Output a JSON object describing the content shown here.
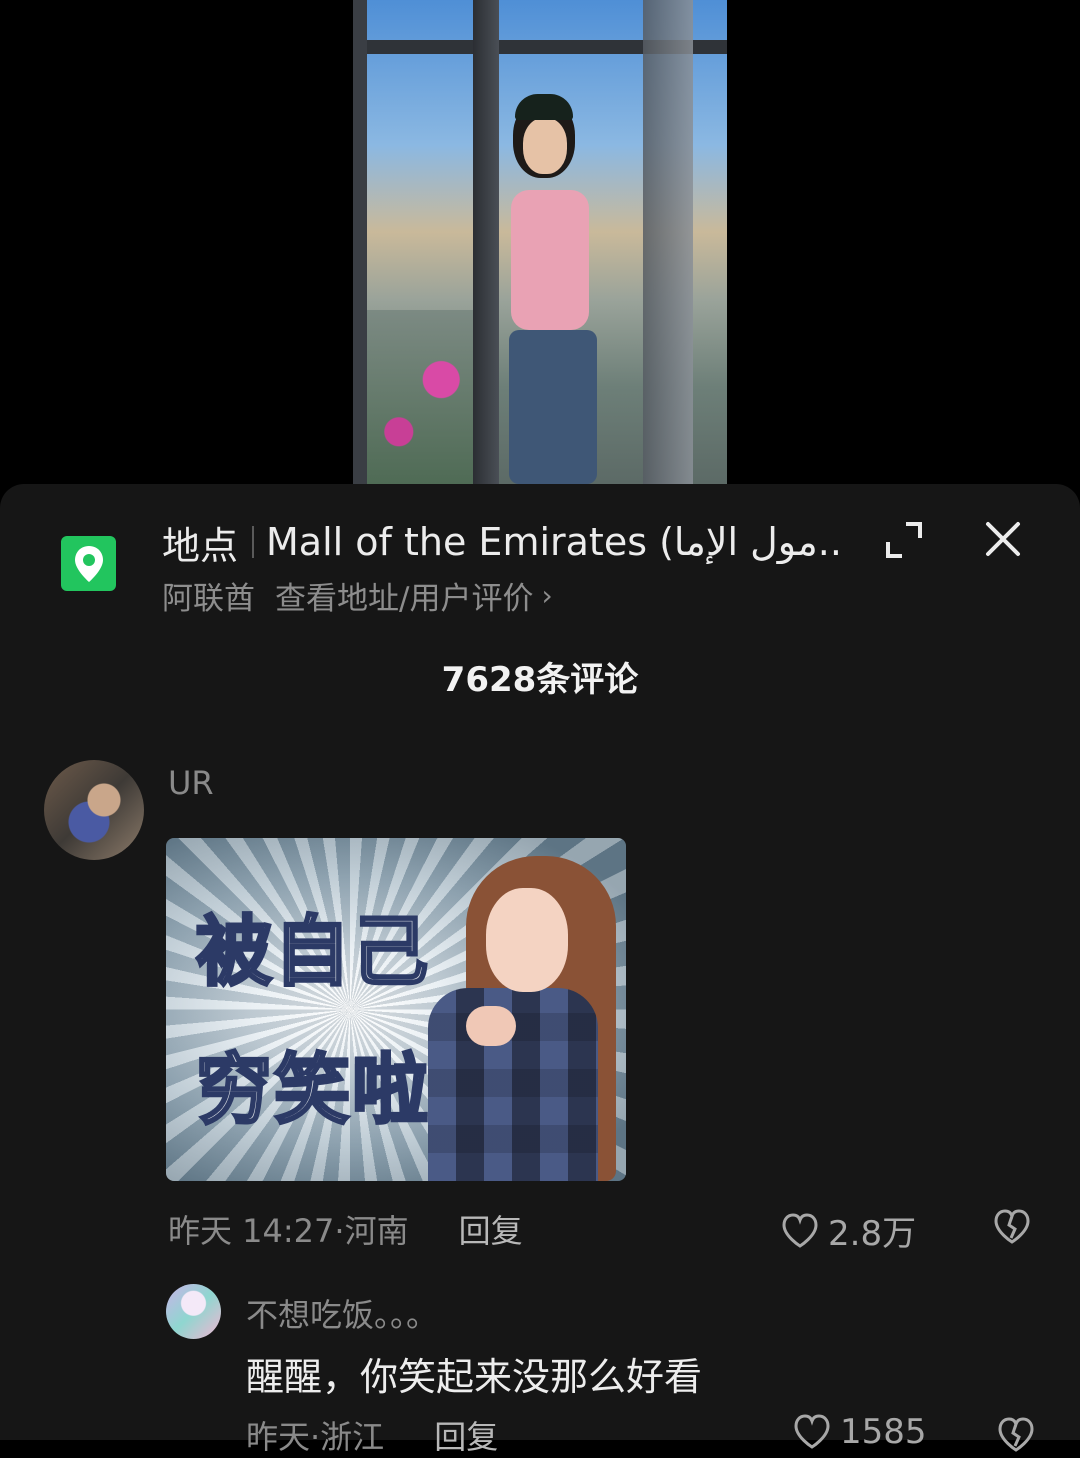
{
  "location": {
    "label": "地点",
    "name": "Mall of the Emirates (مول الإما..",
    "country": "阿联酋",
    "detail_link": "查看地址/用户评价"
  },
  "comments_header": {
    "count_text": "7628条评论"
  },
  "comments": [
    {
      "username": "UR",
      "sticker_text_line1": "被自己",
      "sticker_text_line2": "穷笑啦",
      "time_location": "昨天 14:27·河南",
      "reply_label": "回复",
      "likes": "2.8万",
      "replies": [
        {
          "username": "不想吃饭。。。",
          "text": "醒醒，你笑起来没那么好看",
          "time_location": "昨天·浙江",
          "reply_label": "回复",
          "likes": "1585"
        }
      ]
    }
  ],
  "colors": {
    "panel_bg": "#161616",
    "location_icon": "#22c55e",
    "secondary_text": "#8a8a8a"
  },
  "icons": [
    "location-pin-icon",
    "expand-icon",
    "close-icon",
    "heart-icon",
    "broken-heart-icon",
    "chevron-right-icon"
  ]
}
